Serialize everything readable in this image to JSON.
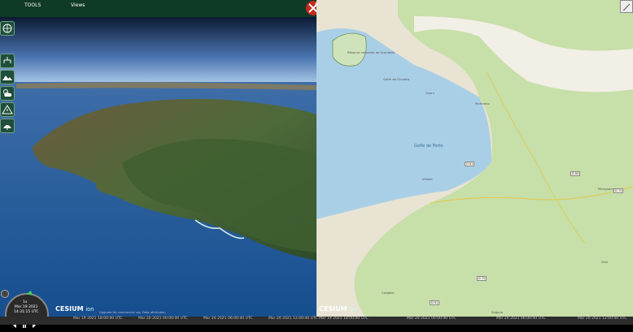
{
  "menu": {
    "tools_label": "TOOLS",
    "views_label": "Views"
  },
  "timeline": {
    "left_ticks": [
      "Mar 19 2021 18:00:00 UTC",
      "Mar 20 2021 00:00:00 UTC",
      "Mar 20 2021 06:00:00 UTC",
      "Mar 20 2021 12:00:00 UTC"
    ],
    "right_ticks": [
      "Mar 19 2021 18:00:00 UTC",
      "Mar 20 2021 00:00:00 UTC",
      "Mar 20 2021 06:00:00 UTC",
      "Mar 20 2021 12:00:00 UTC"
    ]
  },
  "clock": {
    "speed": "1x",
    "date": "Mar 19 2021",
    "time": "14:31:15 UTC"
  },
  "branding": {
    "logo_text": "CESIUM",
    "logo_suffix": "ion"
  },
  "attribution": {
    "upgrade": "Upgrade for commercial use",
    "data": "Data attribution"
  },
  "map_labels": {
    "reserve": "Réserve naturelle de Scandola",
    "gulf": "Golfe de Porto",
    "gulf_small": "Golfe de Girolata",
    "village1": "Osani",
    "village2": "Partinello",
    "village3": "Vistale",
    "village4": "Cargèse",
    "village5": "Vico",
    "village6": "Marignana",
    "village7": "Sagone"
  },
  "roads": [
    "D 81",
    "D 84",
    "D 70",
    "D 81",
    "D 70"
  ],
  "colors": {
    "topbar": "#0f3a26",
    "accent": "#c62a22"
  }
}
